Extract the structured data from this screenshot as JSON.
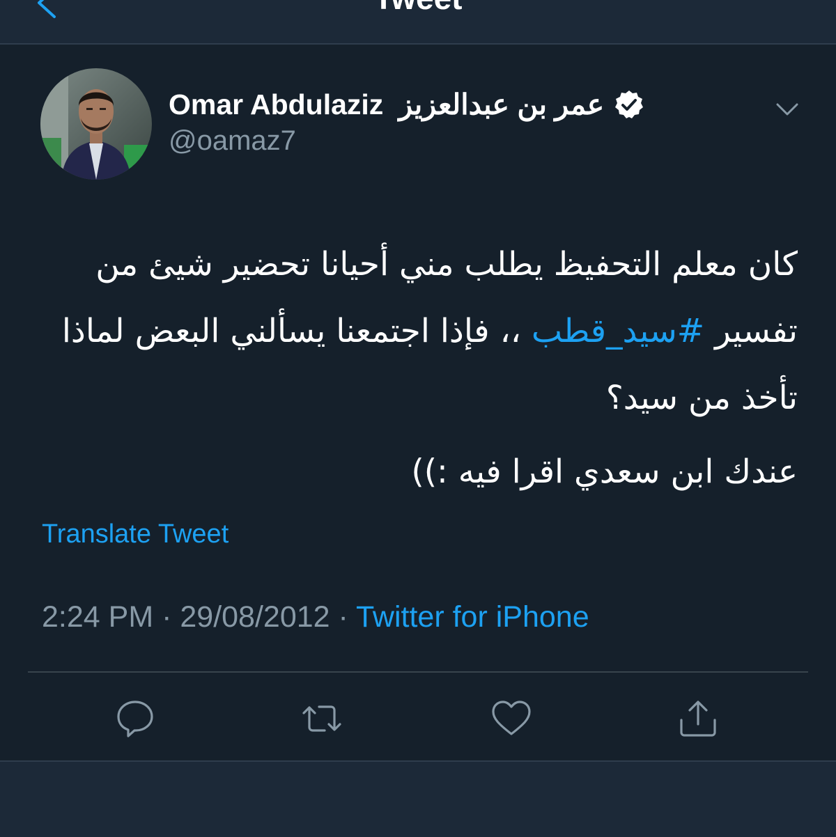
{
  "header": {
    "title": "Tweet"
  },
  "tweet": {
    "author_name_en": "Omar Abdulaziz",
    "author_name_ar": "عمر بن عبدالعزيز",
    "handle": "@oamaz7",
    "body": {
      "line1": "كان معلم التحفيظ يطلب مني أحيانا تحضير شيئ من تفسير ",
      "hashtag": "#سيد_قطب",
      "line1_rest": " ،، فإذا اجتمعنا يسألني البعض لماذا تأخذ من سيد؟",
      "line2": "عندك ابن سعدي اقرا فيه :))"
    },
    "translate_label": "Translate Tweet",
    "time": "2:24 PM",
    "separator": " · ",
    "date": "29/08/2012",
    "source": "Twitter for iPhone"
  },
  "icons": {
    "back": "chevron-left-icon",
    "verified": "verified-badge-icon",
    "caret": "chevron-down-icon",
    "reply": "reply-icon",
    "retweet": "retweet-icon",
    "like": "heart-icon",
    "share": "share-icon"
  },
  "colors": {
    "background": "#15202b",
    "bar": "#1c2938",
    "accent": "#1da1f2",
    "secondary_text": "#8899a6",
    "icon": "#8899a6"
  }
}
